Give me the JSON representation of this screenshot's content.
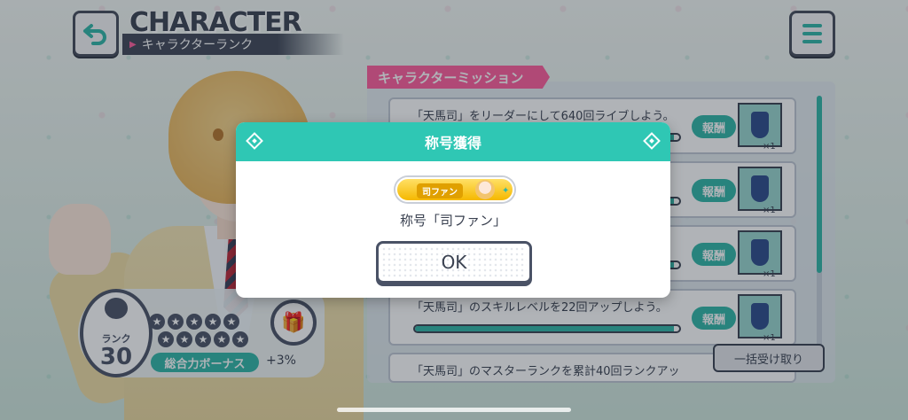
{
  "header": {
    "title": "CHARACTER",
    "subtitle": "キャラクターランク"
  },
  "rank": {
    "label": "ランク",
    "value": "30",
    "bonus_label": "総合力ボーナス",
    "bonus_value": "+3%"
  },
  "missions": {
    "tag": "キャラクターミッション",
    "reward_label": "報酬",
    "items": [
      {
        "text": "「天馬司」をリーダーにして640回ライブしよう。",
        "reward_count": "×1",
        "progress": 0.98
      },
      {
        "text": "",
        "reward_count": "×1",
        "progress": 0.98
      },
      {
        "text": "",
        "reward_count": "×1",
        "progress": 0.98
      },
      {
        "text": "「天馬司」のスキルレベルを22回アップしよう。",
        "reward_count": "×1",
        "progress": 0.98
      },
      {
        "text": "「天馬司」のマスターランクを累計40回ランクアッ",
        "reward_count": "",
        "progress": 0.0
      }
    ],
    "claim_all_label": "一括受け取り"
  },
  "dialog": {
    "title": "称号獲得",
    "badge_text": "司ファン",
    "message": "称号「司ファン」",
    "ok_label": "OK"
  },
  "colors": {
    "accent": "#2fc7b4",
    "pink": "#ff5c9c",
    "dark": "#3a4150"
  }
}
